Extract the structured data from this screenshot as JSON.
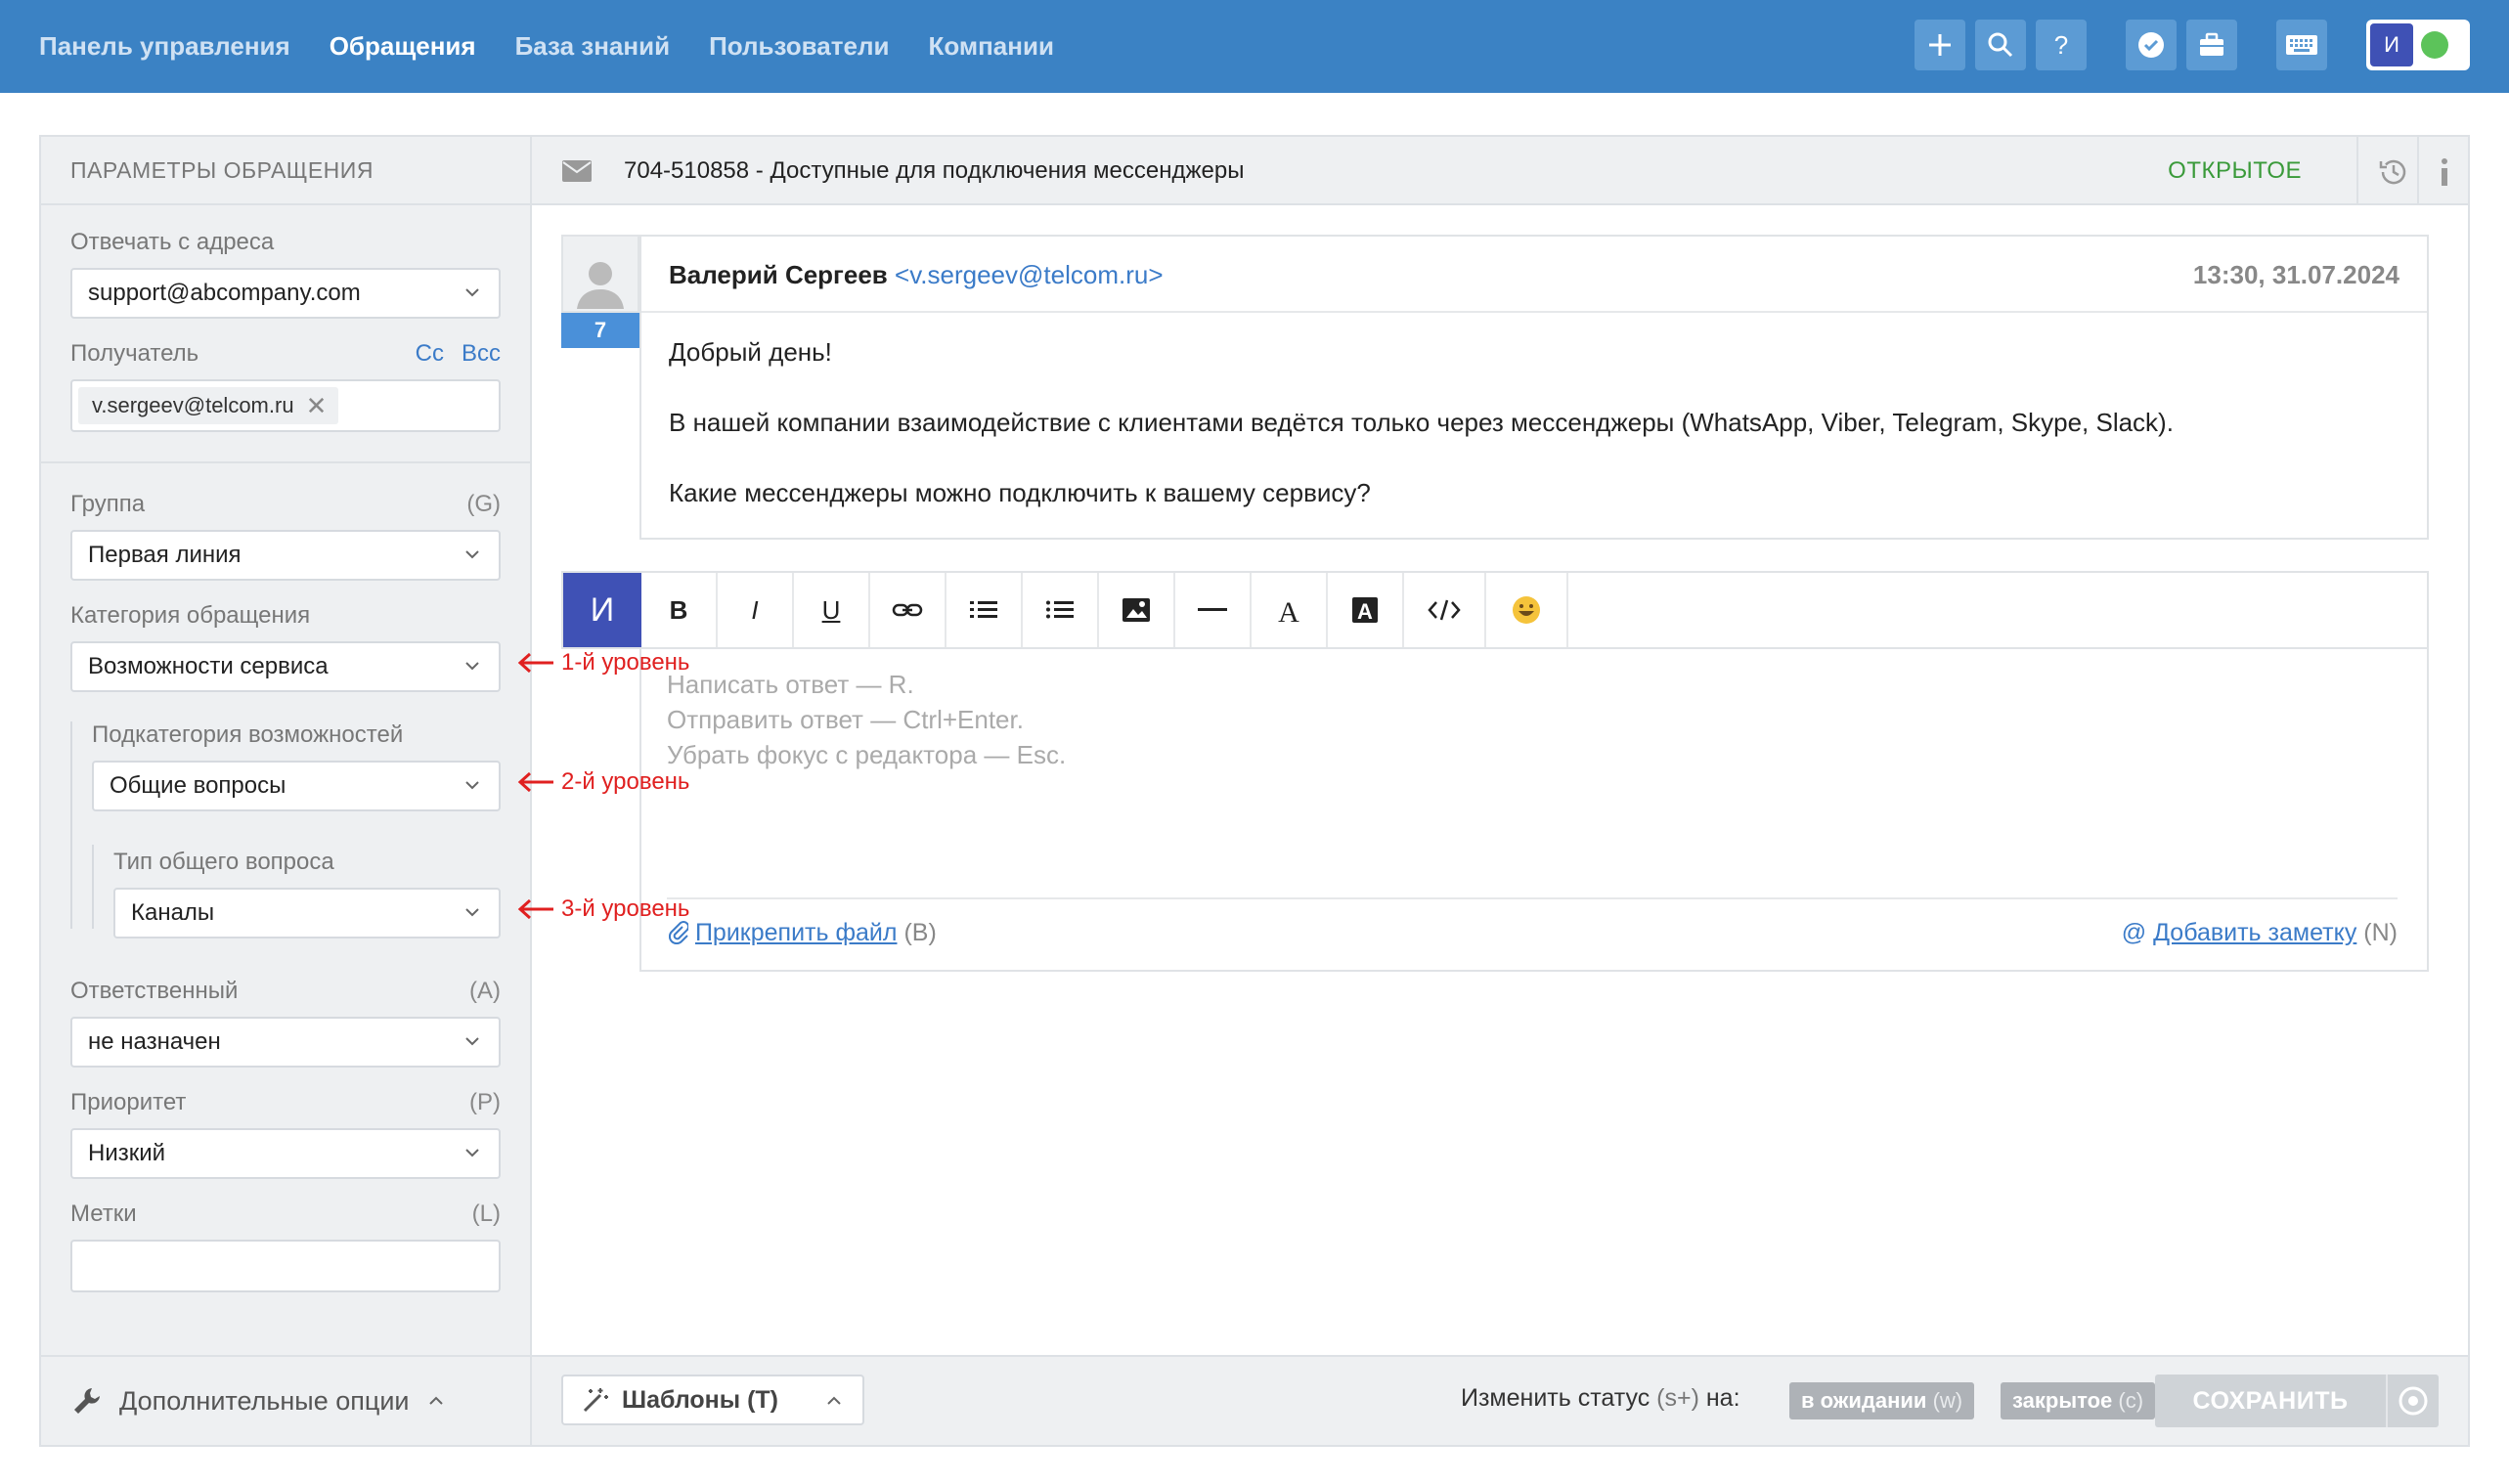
{
  "nav": {
    "items": [
      "Панель управления",
      "Обращения",
      "База знаний",
      "Пользователи",
      "Компании"
    ],
    "active_index": 1
  },
  "topbar": {
    "icons": [
      "plus-icon",
      "search-icon",
      "help-icon",
      "check-badge-icon",
      "briefcase-icon",
      "keyboard-icon"
    ],
    "user_initial": "И",
    "accent": "#3b82c4",
    "online_color": "#5cc35a"
  },
  "sidebar": {
    "header": "ПАРАМЕТРЫ ОБРАЩЕНИЯ",
    "reply_from_label": "Отвечать с адреса",
    "reply_from_value": "support@abcompany.com",
    "recipient_label": "Получатель",
    "cc": "Cc",
    "bcc": "Bcc",
    "recipient_tag": "v.sergeev@telcom.ru",
    "group_label": "Группа",
    "group_key": "(G)",
    "group_value": "Первая линия",
    "category_label": "Категория обращения",
    "category_value": "Возможности сервиса",
    "subcategory_label": "Подкатегория возможностей",
    "subcategory_value": "Общие вопросы",
    "type_label": "Тип общего вопроса",
    "type_value": "Каналы",
    "assignee_label": "Ответственный",
    "assignee_key": "(A)",
    "assignee_value": "не назначен",
    "priority_label": "Приоритет",
    "priority_key": "(P)",
    "priority_value": "Низкий",
    "tags_label": "Метки",
    "tags_key": "(L)",
    "footer": "Дополнительные опции"
  },
  "annotations": [
    "1-й уровень",
    "2-й уровень",
    "3-й уровень"
  ],
  "ticket": {
    "title": "704-510858 - Доступные для подключения мессенджеры",
    "status": "ОТКРЫТОЕ",
    "status_color": "#3a9a3a"
  },
  "message": {
    "sender": "Валерий Сергеев",
    "email": "<v.sergeev@telcom.ru>",
    "datetime": "13:30, 31.07.2024",
    "count": "7",
    "body": [
      "Добрый день!",
      "В нашей компании взаимодействие с клиентами ведётся только через мессенджеры (WhatsApp, Viber, Telegram, Skype, Slack).",
      "Какие мессенджеры можно подключить к вашему сервису?"
    ]
  },
  "editor": {
    "mode": "И",
    "toolbar": [
      "bold-icon",
      "italic-icon",
      "underline-icon",
      "link-icon",
      "numbered-list-icon",
      "bullet-list-icon",
      "image-icon",
      "horizontal-rule-icon",
      "font-color-icon",
      "background-color-icon",
      "code-icon",
      "emoji-icon"
    ],
    "hints": [
      "Написать ответ — R.",
      "Отправить ответ — Ctrl+Enter.",
      "Убрать фокус с редактора — Esc."
    ],
    "attach_link": "Прикрепить файл",
    "attach_key": "(B)",
    "note_link": "Добавить заметку",
    "note_key": "(N)"
  },
  "footer": {
    "templates": "Шаблоны (T)",
    "change_status_prefix": "Изменить статус",
    "change_status_key": "(s+)",
    "change_status_suffix": "на:",
    "pending": "в ожидании",
    "pending_key": "(w)",
    "closed": "закрытое",
    "closed_key": "(c)",
    "save": "СОХРАНИТЬ"
  }
}
